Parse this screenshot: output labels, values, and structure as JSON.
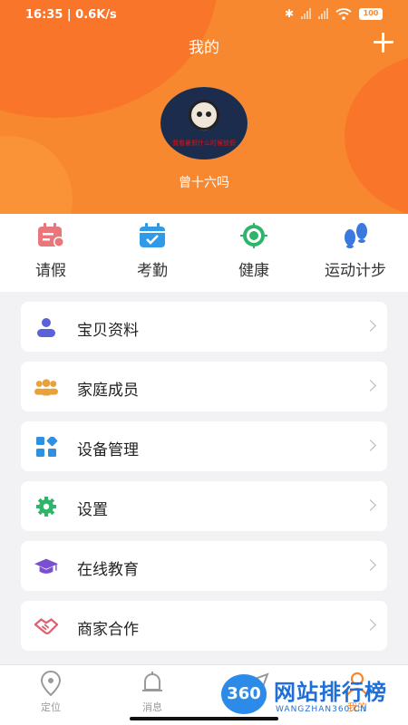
{
  "status": {
    "time": "16:35 | 0.6K/s",
    "battery": "100"
  },
  "header": {
    "title": "我的",
    "username": "曾十六吗",
    "avatar_caption": "我看暑假什么时候放假"
  },
  "quick_actions": [
    {
      "label": "请假",
      "icon": "calendar-leave-icon",
      "color": "#e8767a"
    },
    {
      "label": "考勤",
      "icon": "calendar-check-icon",
      "color": "#2f9ae8"
    },
    {
      "label": "健康",
      "icon": "health-target-icon",
      "color": "#2fb56a"
    },
    {
      "label": "运动计步",
      "icon": "footsteps-icon",
      "color": "#3a7ae0"
    }
  ],
  "menu": [
    {
      "label": "宝贝资料",
      "icon": "child-profile-icon",
      "color": "#5b62d8"
    },
    {
      "label": "家庭成员",
      "icon": "family-members-icon",
      "color": "#e8a23a"
    },
    {
      "label": "设备管理",
      "icon": "device-grid-icon",
      "color": "#2f8fe0"
    },
    {
      "label": "设置",
      "icon": "gear-icon",
      "color": "#2fb56a"
    },
    {
      "label": "在线教育",
      "icon": "graduation-cap-icon",
      "color": "#7a4fd0"
    },
    {
      "label": "商家合作",
      "icon": "handshake-icon",
      "color": "#e06070"
    }
  ],
  "bottom_nav": [
    {
      "label": "定位",
      "icon": "location-pin-icon"
    },
    {
      "label": "消息",
      "icon": "bell-icon"
    },
    {
      "label": "",
      "icon": "send-icon"
    },
    {
      "label": "我的",
      "icon": "user-icon",
      "active": true
    }
  ],
  "watermark": {
    "badge": "360",
    "text": "网站排行榜",
    "sub": "WANGZHAN360.CN"
  },
  "colors": {
    "accent": "#f7882f"
  }
}
